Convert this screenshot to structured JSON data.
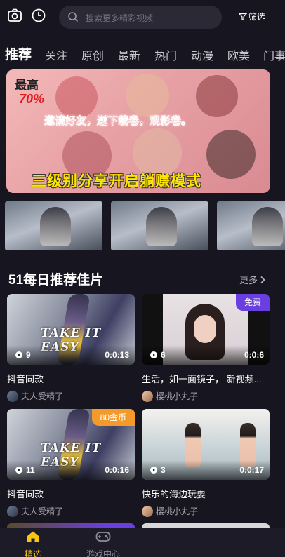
{
  "header": {
    "camera_icon": "camera-icon",
    "history_icon": "clock-icon",
    "search_placeholder": "搜索更多精彩视频",
    "filter_label": "筛选"
  },
  "tabs": [
    {
      "label": "推荐",
      "active": true
    },
    {
      "label": "关注"
    },
    {
      "label": "原创"
    },
    {
      "label": "最新"
    },
    {
      "label": "热门"
    },
    {
      "label": "动漫"
    },
    {
      "label": "欧美"
    },
    {
      "label": "门事"
    }
  ],
  "banner": {
    "line1": "最高",
    "line2": "70%",
    "line3": "邀请好友，送下载卷，观影卷。",
    "line4": "三级别分享开启躺赚模式"
  },
  "section": {
    "title": "51每日推荐佳片",
    "more_label": "更多"
  },
  "videos": [
    {
      "title": "抖音同款",
      "author": "夫人受精了",
      "views": "9",
      "duration": "0:0:13",
      "badge": ""
    },
    {
      "title": "生活，如一面镜子， 新视频...",
      "author": "樱桃小丸子",
      "views": "6",
      "duration": "0:0:6",
      "badge": "免费",
      "badge_color": "#6a3fe0"
    },
    {
      "title": "抖音同款",
      "author": "夫人受精了",
      "views": "11",
      "duration": "0:0:16",
      "badge": "80金币",
      "badge_color": "#f39a2b"
    },
    {
      "title": "快乐的海边玩耍",
      "author": "樱桃小丸子",
      "views": "3",
      "duration": "0:0:17",
      "badge": ""
    }
  ],
  "bottom_nav": [
    {
      "label": "精选",
      "icon": "home-icon",
      "active": true
    },
    {
      "label": "游戏中心",
      "icon": "gamepad-icon"
    }
  ],
  "colors": {
    "background": "#17151f",
    "accent": "#f7c514"
  }
}
